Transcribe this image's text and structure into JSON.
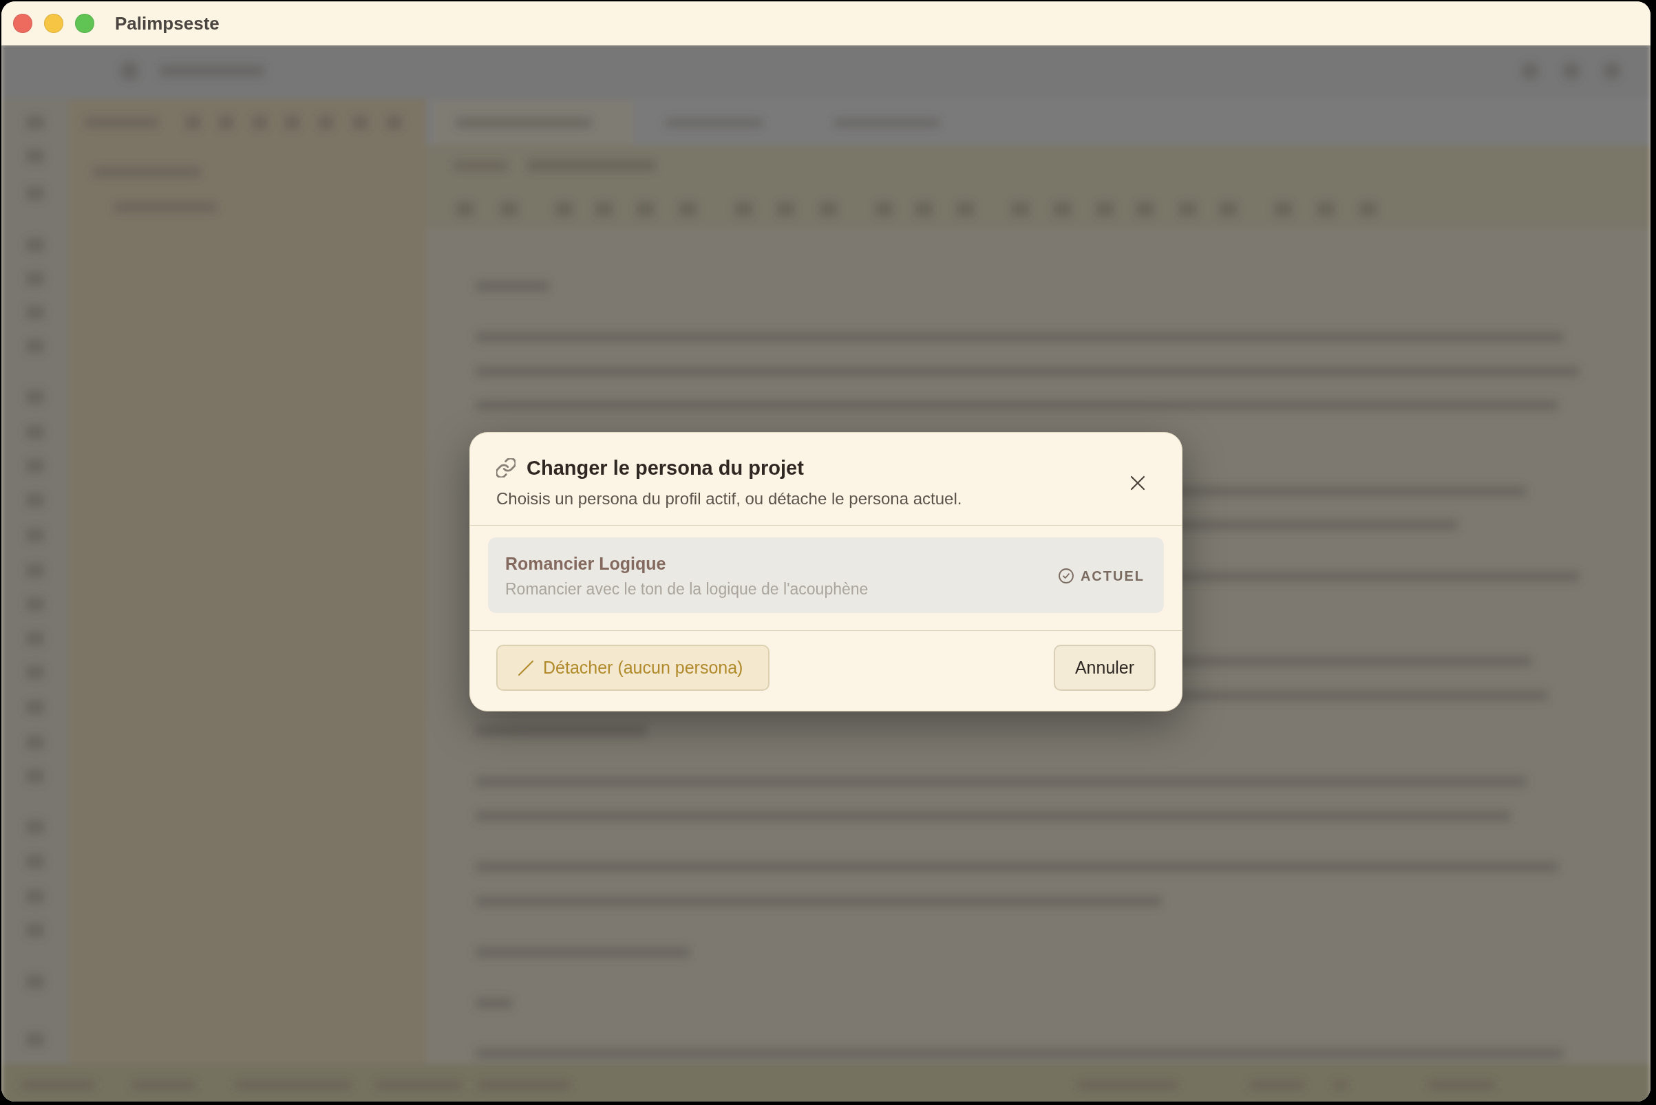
{
  "window": {
    "title": "Palimpseste",
    "controls": [
      {
        "color": "#ed6a5e"
      },
      {
        "color": "#f5c543"
      },
      {
        "color": "#5fc454"
      }
    ]
  },
  "dialog": {
    "title": "Changer le persona du projet",
    "subtitle": "Choisis un persona du profil actif, ou détache le persona actuel.",
    "personas": [
      {
        "name": "Romancier Logique",
        "description": "Romancier avec le ton de la logique de l'acouphène",
        "current": true,
        "current_label": "ACTUEL"
      }
    ],
    "buttons": [
      {
        "kind": "detach",
        "label": "Détacher (aucun persona)"
      },
      {
        "kind": "cancel",
        "label": "Annuler"
      }
    ]
  }
}
